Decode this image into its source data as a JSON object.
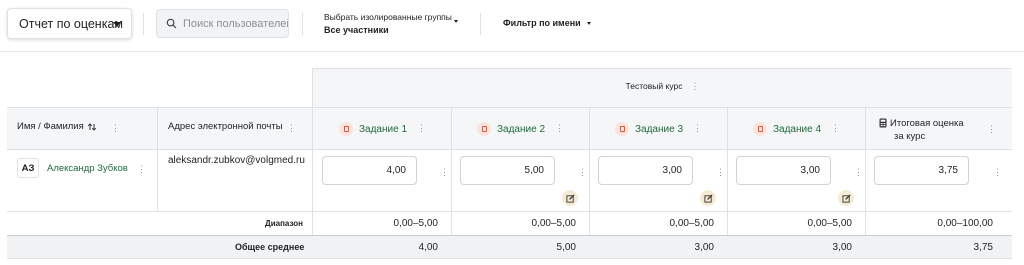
{
  "toolbar": {
    "report_select": "Отчет по оценкам",
    "search_placeholder": "Поиск пользователей",
    "groups_label": "Выбрать изолированные группы",
    "groups_value": "Все участники",
    "name_filter": "Фильтр по имени"
  },
  "course": {
    "title": "Тестовый курс"
  },
  "headers": {
    "name": "Имя / Фамилия",
    "email": "Адрес электронной почты",
    "assignments": [
      "Задание 1",
      "Задание 2",
      "Задание 3",
      "Задание 4"
    ],
    "total_line1": "Итоговая оценка",
    "total_line2": "за курс"
  },
  "student": {
    "initials": "АЗ",
    "name": "Александр Зубков",
    "email": "aleksandr.zubkov@volgmed.ru",
    "grades": [
      "4,00",
      "5,00",
      "3,00",
      "3,00"
    ],
    "total": "3,75"
  },
  "range_row": {
    "label": "Диапазон",
    "values": [
      "0,00–5,00",
      "0,00–5,00",
      "0,00–5,00",
      "0,00–5,00"
    ],
    "total": "0,00–100,00"
  },
  "average_row": {
    "label": "Общее среднее",
    "values": [
      "4,00",
      "5,00",
      "3,00",
      "3,00"
    ],
    "total": "3,75"
  },
  "colors": {
    "accent_link": "#1f6b3a",
    "header_bg": "#f5f6f7",
    "border": "#dee2e6"
  }
}
